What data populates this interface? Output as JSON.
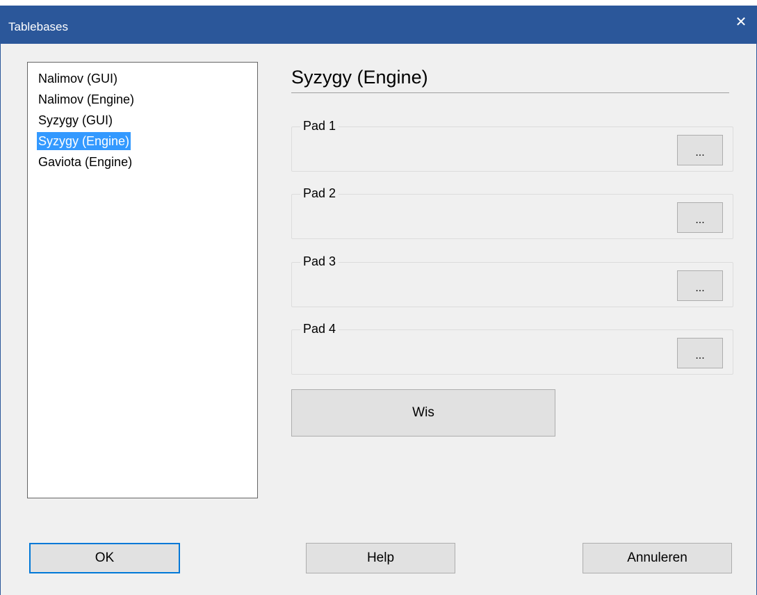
{
  "window": {
    "title": "Tablebases",
    "close_glyph": "✕"
  },
  "list": {
    "items": [
      {
        "label": "Nalimov (GUI)",
        "selected": false
      },
      {
        "label": "Nalimov (Engine)",
        "selected": false
      },
      {
        "label": "Syzygy (GUI)",
        "selected": false
      },
      {
        "label": "Syzygy (Engine)",
        "selected": true
      },
      {
        "label": "Gaviota (Engine)",
        "selected": false
      }
    ]
  },
  "panel": {
    "title": "Syzygy (Engine)",
    "pads": [
      {
        "label": "Pad 1",
        "button": "..."
      },
      {
        "label": "Pad 2",
        "button": "..."
      },
      {
        "label": "Pad 3",
        "button": "..."
      },
      {
        "label": "Pad 4",
        "button": "..."
      }
    ],
    "clear_label": "Wis"
  },
  "footer": {
    "ok_label": "OK",
    "help_label": "Help",
    "cancel_label": "Annuleren"
  },
  "colors": {
    "titlebar": "#2b579a",
    "selection": "#3399ff",
    "default_border": "#0078d7"
  }
}
